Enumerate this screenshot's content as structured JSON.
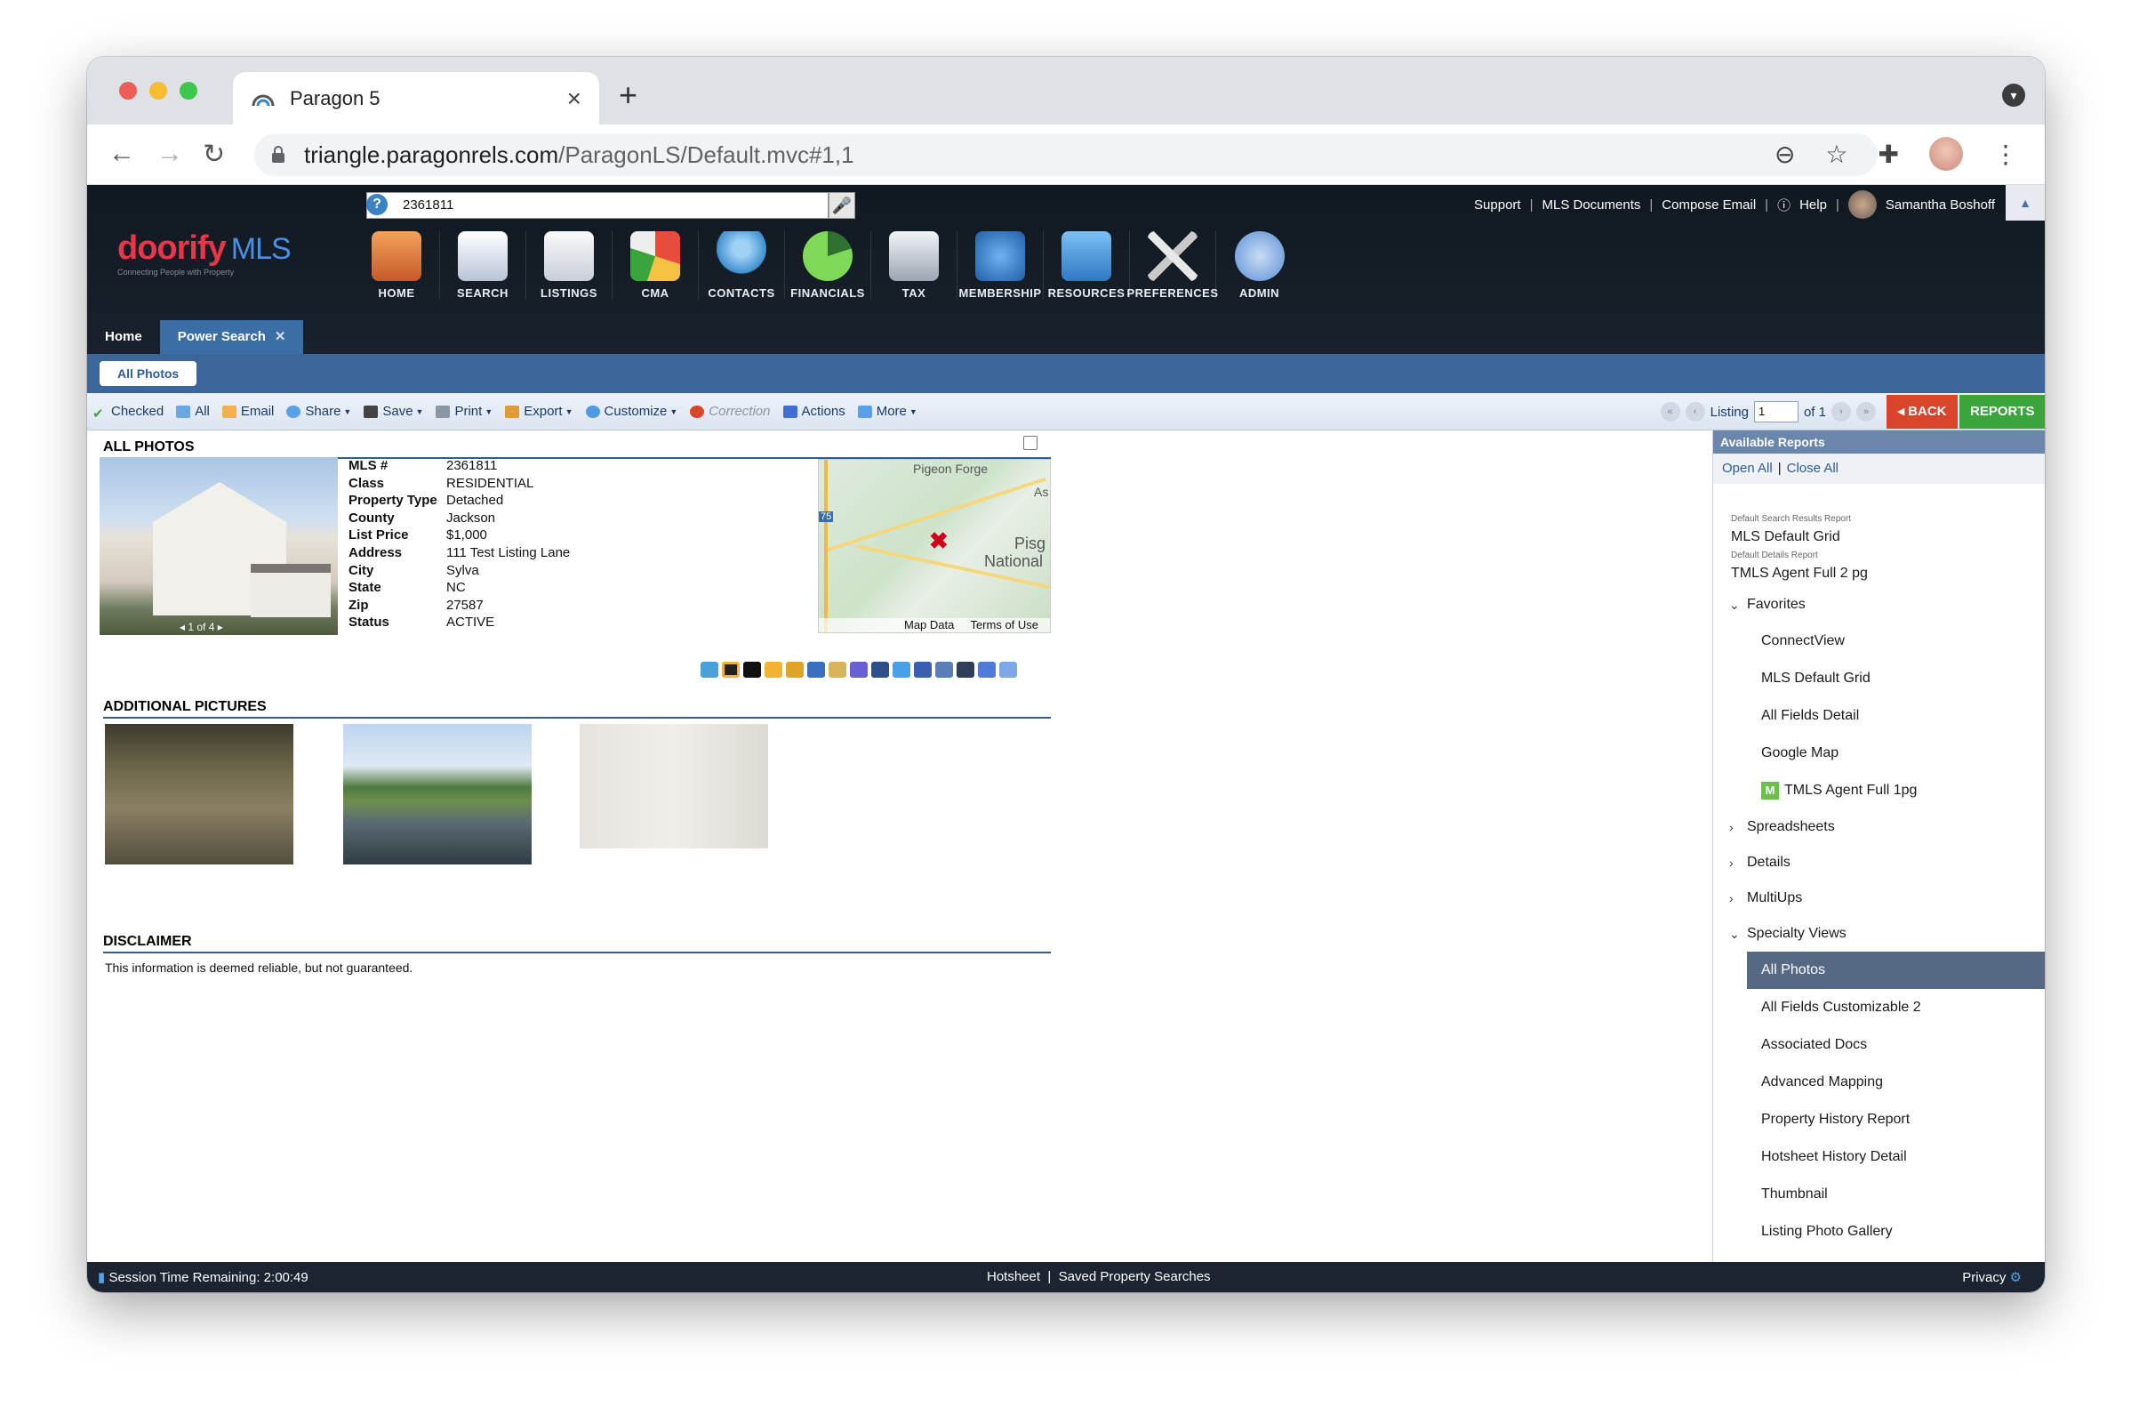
{
  "browser": {
    "tab_title": "Paragon 5",
    "url_host": "triangle.paragonrels.com",
    "url_path": "/ParagonLS/Default.mvc#1,1"
  },
  "app": {
    "logo_main": "doorify",
    "logo_suffix": "MLS",
    "logo_tagline": "Connecting People with Property",
    "search_value": "2361811",
    "help_glyph": "?",
    "top_links": [
      "Support",
      "MLS Documents",
      "Compose Email",
      "Help"
    ],
    "user_name": "Samantha Boshoff",
    "nav": [
      {
        "label": "HOME",
        "icon": "home-icon"
      },
      {
        "label": "SEARCH",
        "icon": "search-icon"
      },
      {
        "label": "LISTINGS",
        "icon": "listings-icon"
      },
      {
        "label": "CMA",
        "icon": "cma-icon"
      },
      {
        "label": "CONTACTS",
        "icon": "contacts-icon"
      },
      {
        "label": "FINANCIALS",
        "icon": "financials-icon"
      },
      {
        "label": "TAX",
        "icon": "tax-icon"
      },
      {
        "label": "MEMBERSHIP",
        "icon": "membership-icon"
      },
      {
        "label": "RESOURCES",
        "icon": "resources-icon"
      },
      {
        "label": "PREFERENCES",
        "icon": "preferences-icon"
      },
      {
        "label": "ADMIN",
        "icon": "admin-icon"
      }
    ],
    "tabs": [
      "Home",
      "Power Search"
    ],
    "subtab": "All Photos"
  },
  "toolbar": {
    "items": [
      "Checked",
      "All",
      "Email",
      "Share",
      "Save",
      "Print",
      "Export",
      "Customize",
      "Correction",
      "Actions",
      "More"
    ],
    "listing_label": "Listing",
    "listing_value": "1",
    "listing_of": "of 1",
    "back": "BACK",
    "reports": "REPORTS"
  },
  "listing": {
    "section_all_photos": "ALL PHOTOS",
    "photo_counter": "1 of 4",
    "facts": [
      {
        "k": "MLS #",
        "v": "2361811"
      },
      {
        "k": "Class",
        "v": "RESIDENTIAL"
      },
      {
        "k": "Property Type",
        "v": "Detached"
      },
      {
        "k": "County",
        "v": "Jackson"
      },
      {
        "k": "List Price",
        "v": "$1,000"
      },
      {
        "k": "Address",
        "v": "111 Test Listing Lane"
      },
      {
        "k": "City",
        "v": "Sylva"
      },
      {
        "k": "State",
        "v": "NC"
      },
      {
        "k": "Zip",
        "v": "27587"
      },
      {
        "k": "Status",
        "v": "ACTIVE"
      }
    ],
    "map_labels": [
      "Pigeon Forge",
      "As",
      "Pisg",
      "National",
      "75"
    ],
    "map_data": "Map Data",
    "map_terms": "Terms of Use",
    "section_additional": "ADDITIONAL PICTURES",
    "section_disclaimer": "DISCLAIMER",
    "disclaimer_text": "This information is deemed reliable, but not guaranteed."
  },
  "reports": {
    "header": "Available Reports",
    "open_all": "Open All",
    "close_all": "Close All",
    "default_search_label": "Default Search Results Report",
    "default_search": "MLS Default Grid",
    "default_details_label": "Default Details Report",
    "default_details": "TMLS Agent Full 2 pg",
    "favorites": "Favorites",
    "favorites_items": [
      "ConnectView",
      "MLS Default Grid",
      "All Fields Detail",
      "Google Map",
      "TMLS Agent Full 1pg"
    ],
    "spreadsheets": "Spreadsheets",
    "details": "Details",
    "multiups": "MultiUps",
    "specialty": "Specialty Views",
    "specialty_items": [
      "All Photos",
      "All Fields Customizable 2",
      "Associated Docs",
      "Advanced Mapping",
      "Property History Report",
      "Hotsheet History Detail",
      "Thumbnail",
      "Listing Photo Gallery"
    ],
    "m_badge": "M"
  },
  "footer": {
    "session": "Session Time Remaining: 2:00:49",
    "hotsheet": "Hotsheet",
    "saved_searches": "Saved Property Searches",
    "privacy": "Privacy"
  },
  "colors": {
    "header_bg": "#101821",
    "strip_blue": "#3c6699",
    "back_red": "#d9452b",
    "reports_green": "#3aa53a",
    "selected_row": "#556985"
  }
}
